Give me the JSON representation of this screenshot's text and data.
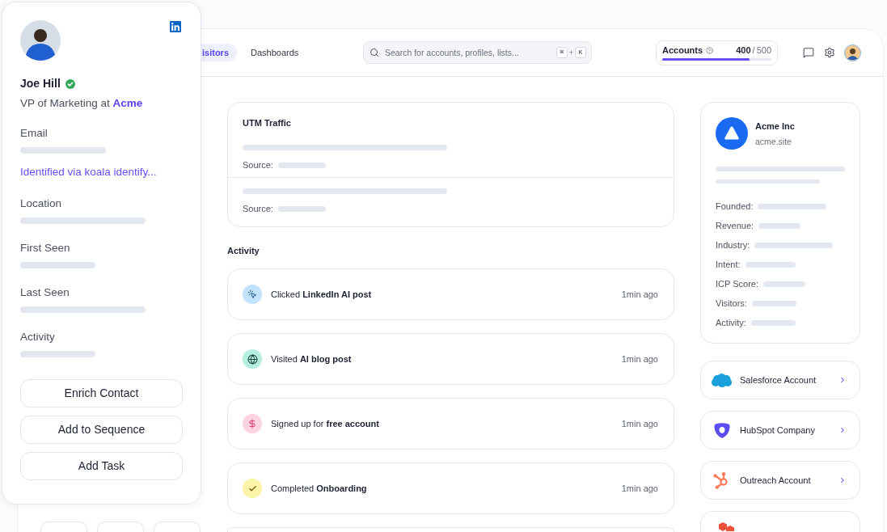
{
  "contact": {
    "name": "Joe Hill",
    "verified": true,
    "job_title": "VP of Marketing at",
    "company": "Acme",
    "fields": [
      {
        "label": "Email",
        "note": "Identified via koala identify..."
      },
      {
        "label": "Location"
      },
      {
        "label": "First Seen"
      },
      {
        "label": "Last Seen"
      },
      {
        "label": "Activity"
      }
    ],
    "actions": [
      "Enrich Contact",
      "Add to Sequence",
      "Add Task"
    ]
  },
  "header": {
    "tabs": [
      {
        "label": "isitors",
        "selected": true
      },
      {
        "label": "Dashboards",
        "selected": false
      }
    ],
    "search": {
      "placeholder": "Search for accounts, profiles, lists...",
      "shortcut": [
        "⌘",
        "+",
        "K"
      ]
    },
    "accounts": {
      "label": "Accounts",
      "used": "400",
      "separator": "/",
      "limit": "500",
      "level": 0.8
    }
  },
  "utm": {
    "title": "UTM Traffic",
    "rows": [
      {
        "source_label": "Source:"
      },
      {
        "source_label": "Source:"
      }
    ]
  },
  "activity": {
    "title": "Activity",
    "items": [
      {
        "kind": "click",
        "text": "Clicked **LinkedIn AI post**",
        "time": "1min ago"
      },
      {
        "kind": "visit",
        "text": "Visited **AI blog post**",
        "time": "1min ago"
      },
      {
        "kind": "signup",
        "text": "Signed up for **free account**",
        "time": "1min ago"
      },
      {
        "kind": "complete",
        "text": "Completed **Onboarding**",
        "time": "1min ago"
      }
    ]
  },
  "company": {
    "name": "Acme Inc",
    "domain": "acme.site",
    "fields": [
      "Founded:",
      "Revenue:",
      "Industry:",
      "Intent:",
      "ICP Score:",
      "Visitors:",
      "Activity:"
    ]
  },
  "integrations": [
    {
      "kind": "cloud",
      "label": "Salesforce Account"
    },
    {
      "kind": "shield",
      "label": "HubSpot Company"
    },
    {
      "kind": "sprocket",
      "label": "Outreach Account"
    },
    {
      "kind": "hexagon"
    }
  ]
}
